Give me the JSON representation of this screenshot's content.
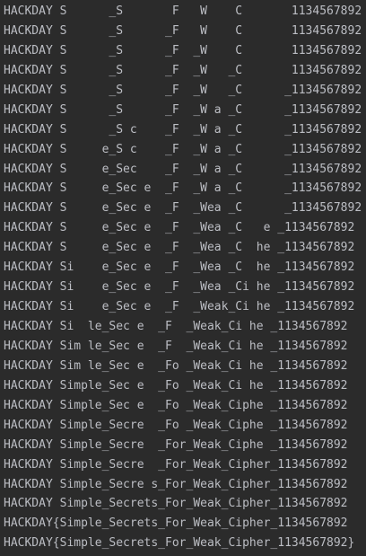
{
  "console": {
    "lines": [
      "HACKDAY S      _S       F   W    C       1134567892",
      "HACKDAY S      _S      _F   W    C       1134567892",
      "HACKDAY S      _S      _F  _W    C       1134567892",
      "HACKDAY S      _S      _F  _W   _C       1134567892",
      "HACKDAY S      _S      _F  _W   _C      _1134567892",
      "HACKDAY S      _S      _F  _W a _C      _1134567892",
      "HACKDAY S      _S c    _F  _W a _C      _1134567892",
      "HACKDAY S     e_S c    _F  _W a _C      _1134567892",
      "HACKDAY S     e_Sec    _F  _W a _C      _1134567892",
      "HACKDAY S     e_Sec e  _F  _W a _C      _1134567892",
      "HACKDAY S     e_Sec e  _F  _Wea _C      _1134567892",
      "HACKDAY S     e_Sec e  _F  _Wea _C   e _1134567892",
      "HACKDAY S     e_Sec e  _F  _Wea _C  he _1134567892",
      "HACKDAY Si    e_Sec e  _F  _Wea _C  he _1134567892",
      "HACKDAY Si    e_Sec e  _F  _Wea _Ci he _1134567892",
      "HACKDAY Si    e_Sec e  _F  _Weak_Ci he _1134567892",
      "HACKDAY Si  le_Sec e  _F  _Weak_Ci he _1134567892",
      "HACKDAY Sim le_Sec e  _F  _Weak_Ci he _1134567892",
      "HACKDAY Sim le_Sec e  _Fo _Weak_Ci he _1134567892",
      "HACKDAY Simple_Sec e  _Fo _Weak_Ci he _1134567892",
      "HACKDAY Simple_Sec e  _Fo _Weak_Ciphe _1134567892",
      "HACKDAY Simple_Secre  _Fo _Weak_Ciphe _1134567892",
      "HACKDAY Simple_Secre  _For_Weak_Ciphe _1134567892",
      "HACKDAY Simple_Secre  _For_Weak_Cipher_1134567892",
      "HACKDAY Simple_Secre s_For_Weak_Cipher_1134567892",
      "HACKDAY Simple_Secrets_For_Weak_Cipher_1134567892",
      "HACKDAY{Simple_Secrets_For_Weak_Cipher_1134567892",
      "HACKDAY{Simple_Secrets_For_Weak_Cipher_1134567892}"
    ]
  },
  "colors": {
    "background": "#2b2b2b",
    "text": "#bcbec4"
  }
}
